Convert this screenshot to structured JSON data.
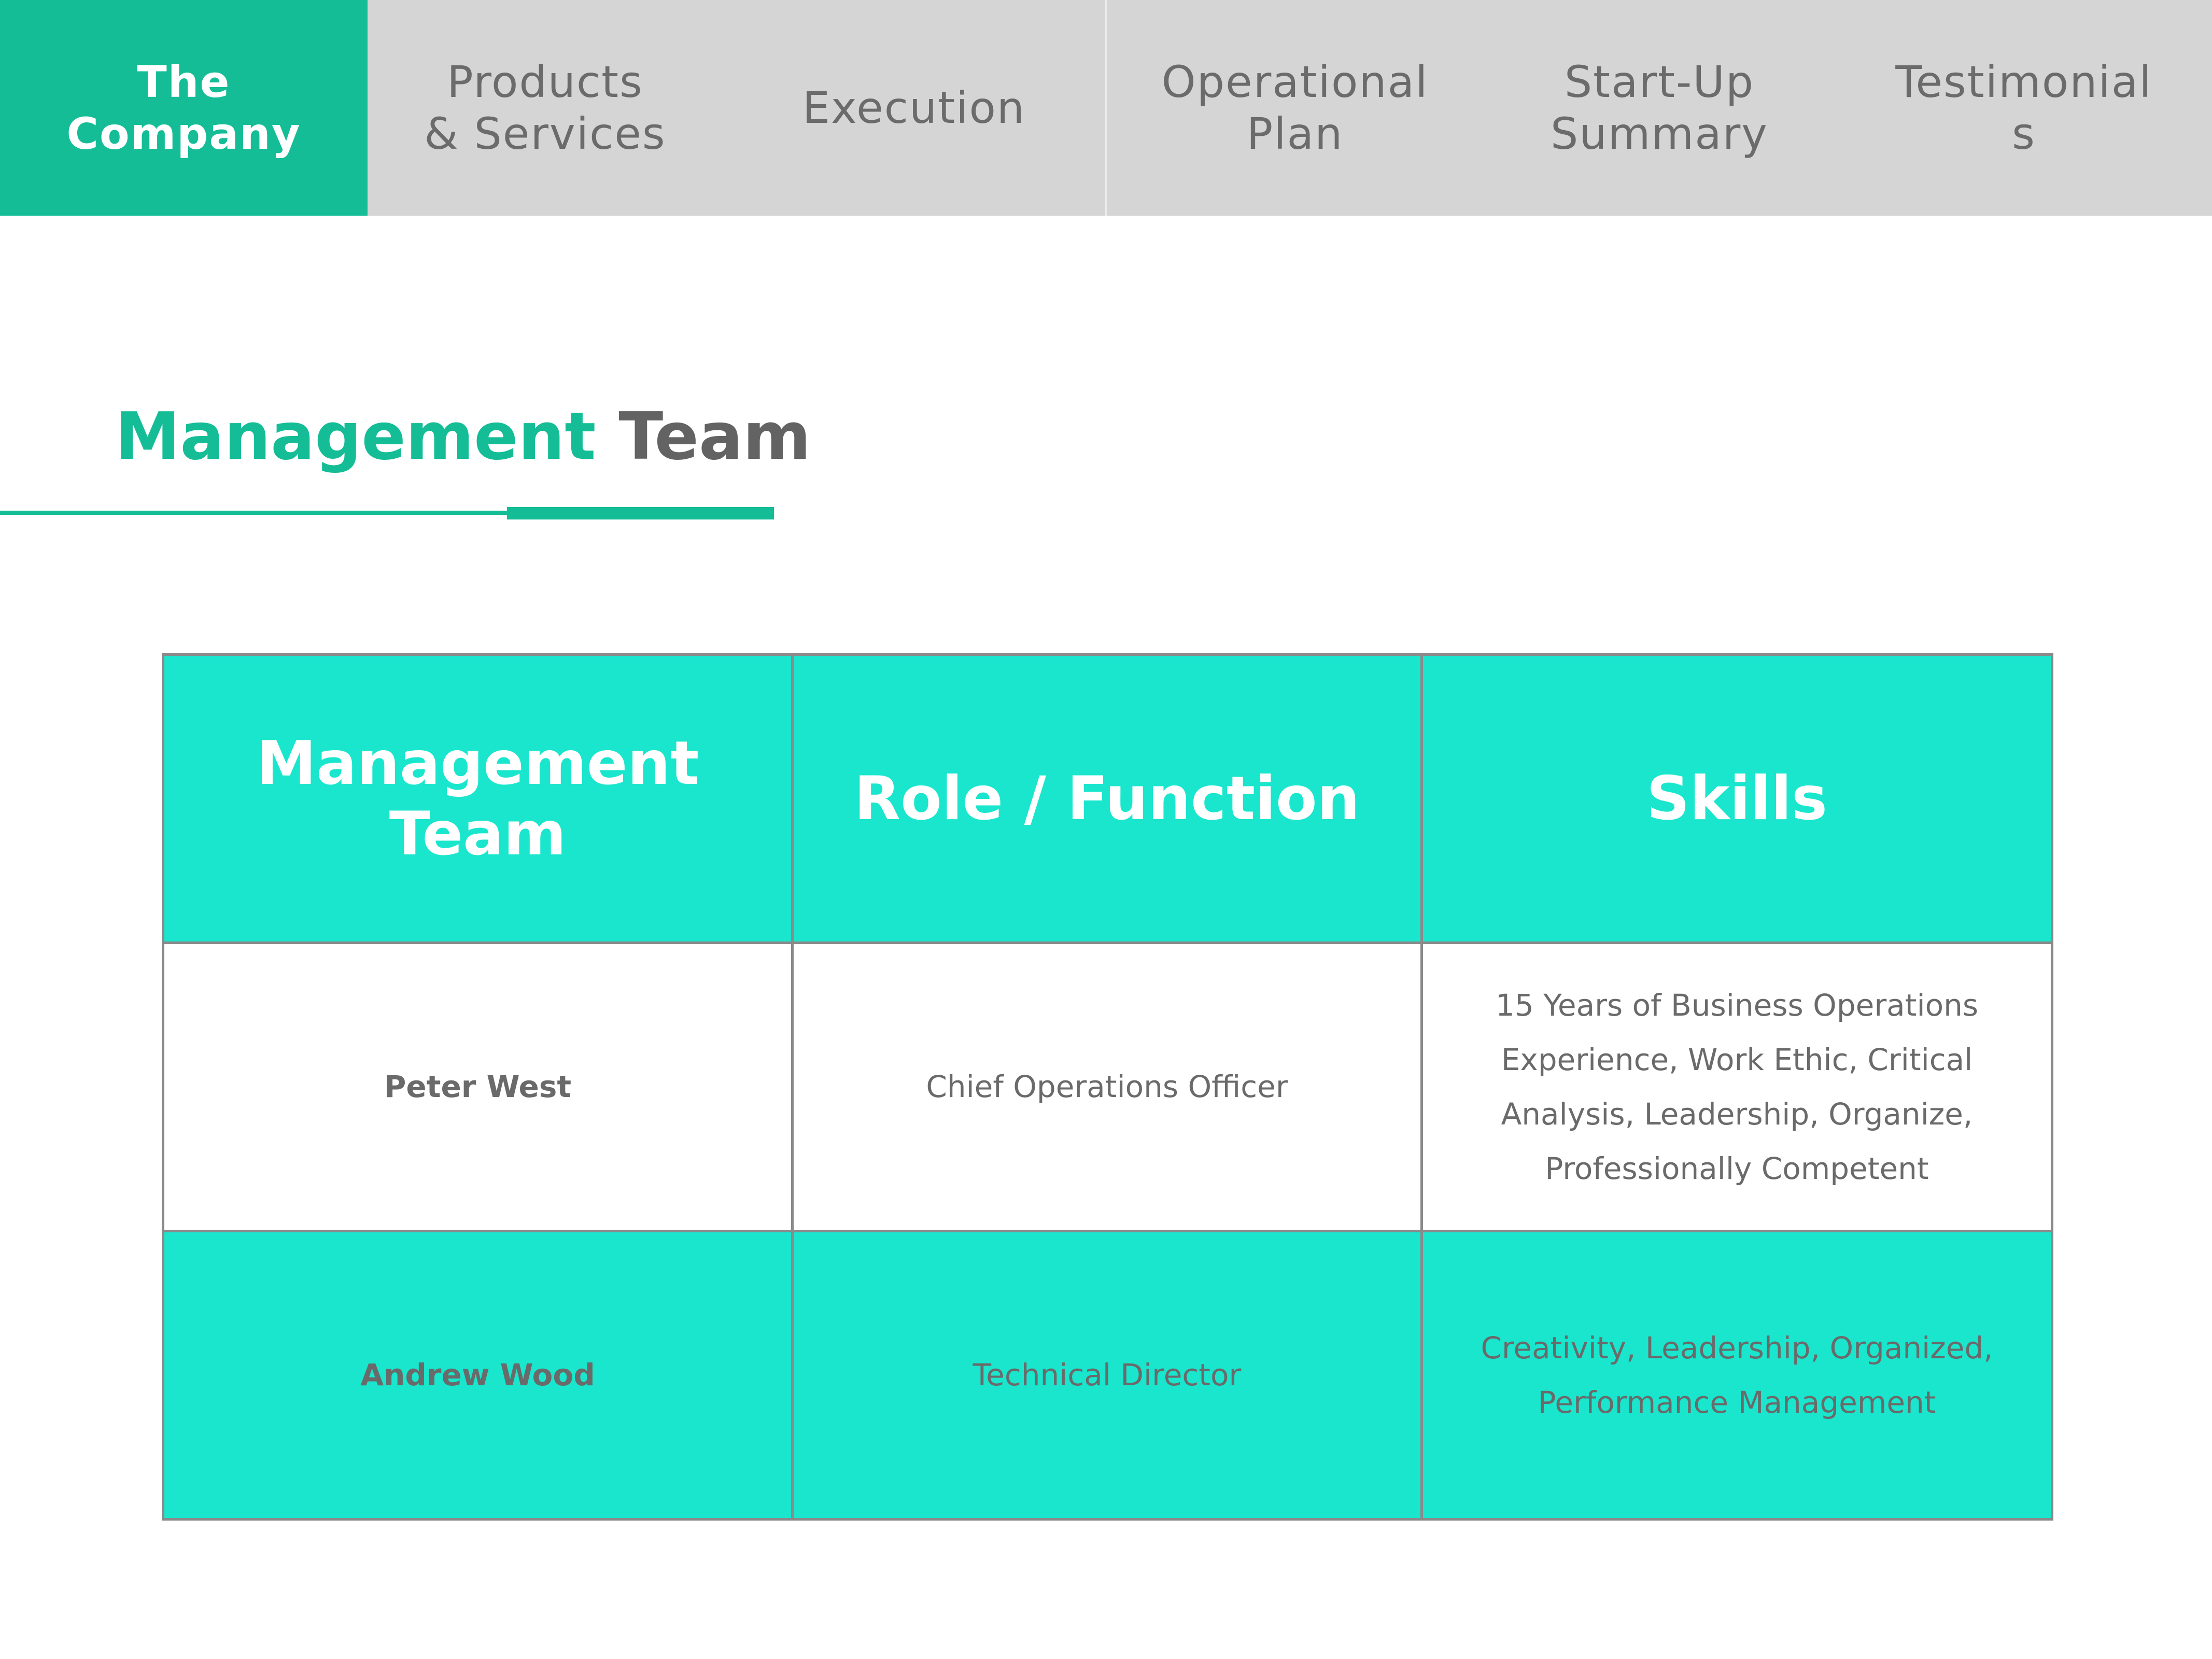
{
  "nav": {
    "tabs": [
      {
        "label": "The\nCompany",
        "active": true
      },
      {
        "label": "Products\n& Services",
        "active": false
      },
      {
        "label": "Execution",
        "active": false
      },
      {
        "label": "Operational\nPlan",
        "active": false
      },
      {
        "label": "Start-Up\nSummary",
        "active": false
      },
      {
        "label": "Testimonial\ns",
        "active": false
      }
    ]
  },
  "heading": {
    "accent": "Management",
    "plain": "Team"
  },
  "table": {
    "headers": [
      "Management Team",
      "Role / Function",
      "Skills"
    ],
    "rows": [
      {
        "name": "Peter West",
        "role": "Chief Operations Officer",
        "skills": "15 Years of Business Operations Experience, Work Ethic, Critical Analysis, Leadership, Organize, Professionally Competent"
      },
      {
        "name": "Andrew Wood",
        "role": "Technical Director",
        "skills": "Creativity, Leadership, Organized, Performance Management"
      }
    ]
  },
  "colors": {
    "brand_green": "#14bd96",
    "table_teal": "#19e6cd",
    "tab_gray": "#d5d5d5",
    "text_gray": "#6a6a6a"
  }
}
